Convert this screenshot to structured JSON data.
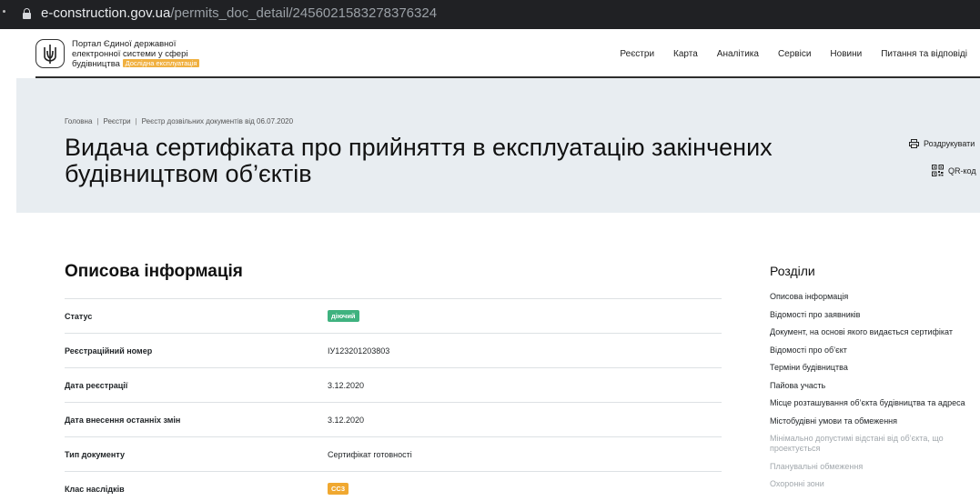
{
  "browser": {
    "url_host": "e-construction.gov.ua",
    "url_path": "/permits_doc_detail/2456021583278376324"
  },
  "header": {
    "portal_name": "Портал Єдиної державної електронної системи у сфері будівництва",
    "badge": "Дослідна експлуатація",
    "nav": [
      "Реєстри",
      "Карта",
      "Аналітика",
      "Сервіси",
      "Новини",
      "Питання та відповіді"
    ]
  },
  "hero": {
    "breadcrumb": [
      "Головна",
      "Реєстри",
      "Реєстр дозвільних документів від 06.07.2020"
    ],
    "title": "Видача сертифіката про прийняття в експлуатацію закінчених будівництвом об’єктів",
    "print_label": "Роздрукувати",
    "qr_label": "QR-код"
  },
  "main": {
    "section_title": "Описова інформація",
    "rows": [
      {
        "label": "Статус",
        "value": "діючий",
        "kind": "pill-green"
      },
      {
        "label": "Реєстраційний номер",
        "value": "ІУ123201203803",
        "kind": "text"
      },
      {
        "label": "Дата реєстрації",
        "value": "3.12.2020",
        "kind": "text"
      },
      {
        "label": "Дата внесення останніх змін",
        "value": "3.12.2020",
        "kind": "text"
      },
      {
        "label": "Тип документу",
        "value": "Сертифікат готовності",
        "kind": "text"
      },
      {
        "label": "Клас наслідків",
        "value": "СС3",
        "kind": "pill-orange"
      }
    ]
  },
  "sidebar": {
    "title": "Розділи",
    "items": [
      {
        "label": "Описова інформація",
        "muted": false
      },
      {
        "label": "Відомості про заявників",
        "muted": false
      },
      {
        "label": "Документ, на основі якого видається сертифікат",
        "muted": false
      },
      {
        "label": "Відомості про об’єкт",
        "muted": false
      },
      {
        "label": "Терміни будівництва",
        "muted": false
      },
      {
        "label": "Пайова участь",
        "muted": false
      },
      {
        "label": "Місце розташування об’єкта будівництва та адреса",
        "muted": false
      },
      {
        "label": "Містобудівні умови та обмеження",
        "muted": false
      },
      {
        "label": "Мінімально допустимі відстані від об’єкта, що проектується",
        "muted": true
      },
      {
        "label": "Планувальні обмеження",
        "muted": true
      },
      {
        "label": "Охоронні зони",
        "muted": true
      }
    ]
  }
}
